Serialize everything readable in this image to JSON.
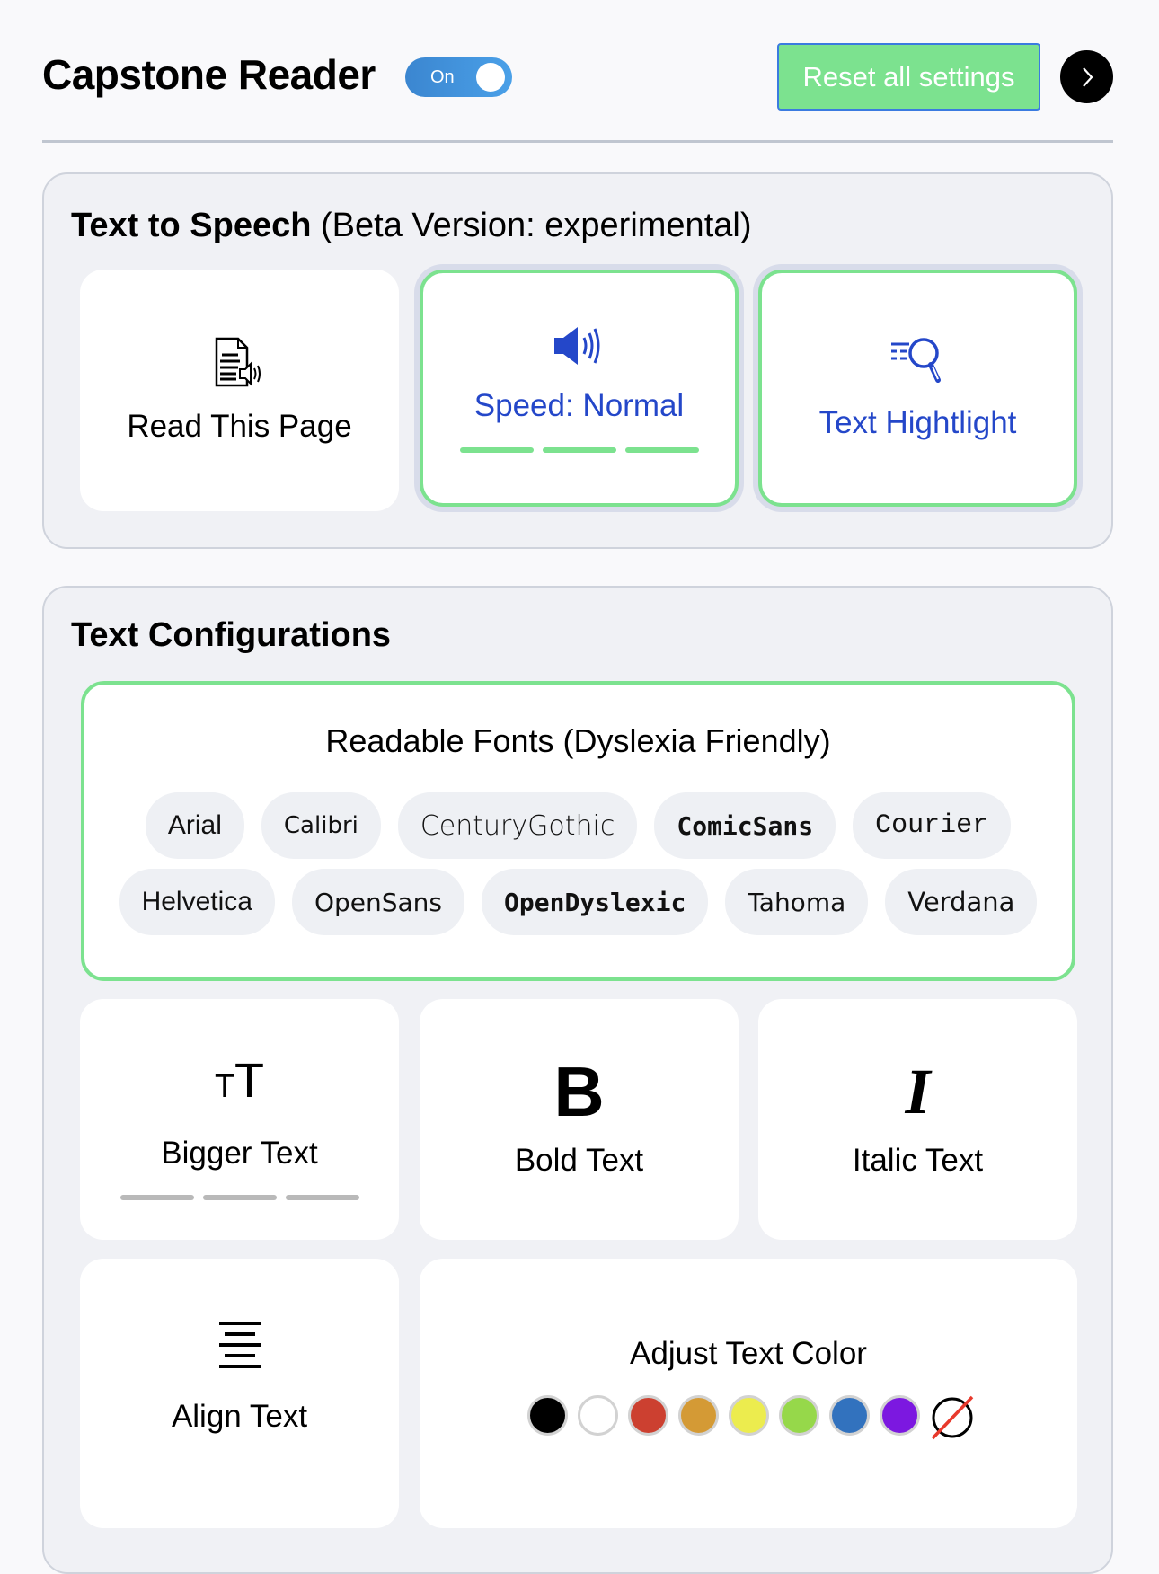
{
  "header": {
    "title": "Capstone Reader",
    "toggle_label": "On",
    "toggle_on": true,
    "reset_label": "Reset all settings",
    "next_icon": "chevron-right-icon"
  },
  "tts": {
    "heading_bold": "Text to Speech",
    "heading_rest": " (Beta Version: experimental)",
    "cards": [
      {
        "label": "Read This Page",
        "icon": "document-speaker-icon",
        "active": false
      },
      {
        "label": "Speed: Normal",
        "icon": "speaker-icon",
        "active": true,
        "level_segments_filled": 3,
        "level_segments_total": 3
      },
      {
        "label": "Text Hightlight",
        "icon": "magnifier-icon",
        "active": true
      }
    ]
  },
  "text_config": {
    "heading": "Text Configurations",
    "fonts": {
      "title": "Readable Fonts (Dyslexia Friendly)",
      "options": [
        "Arial",
        "Calibri",
        "CenturyGothic",
        "ComicSans",
        "Courier",
        "Helvetica",
        "OpenSans",
        "OpenDyslexic",
        "Tahoma",
        "Verdana"
      ]
    },
    "cards": [
      {
        "label": "Bigger Text",
        "icon": "text-size-icon",
        "level_segments_filled": 0,
        "level_segments_total": 3
      },
      {
        "label": "Bold Text",
        "icon": "bold-icon"
      },
      {
        "label": "Italic Text",
        "icon": "italic-icon"
      },
      {
        "label": "Align Text",
        "icon": "align-center-icon"
      }
    ],
    "color": {
      "label": "Adjust Text Color",
      "swatches": [
        "#000000",
        "#ffffff",
        "#cc4030",
        "#d49a35",
        "#ecec4e",
        "#96d84a",
        "#3272be",
        "#7c18e0",
        "none"
      ]
    }
  },
  "colors": {
    "accent_green": "#7ce28f",
    "accent_blue": "#2447c9",
    "toggle_blue": "#3b86d0"
  }
}
